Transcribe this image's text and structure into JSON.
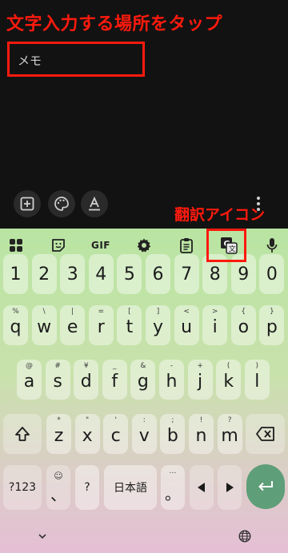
{
  "annotations": {
    "top": "文字入力する場所をタップ",
    "translate_icon": "翻訳アイコン"
  },
  "note": {
    "placeholder": "メモ"
  },
  "bottom_tools": [
    "add-box-icon",
    "palette-icon",
    "text-format-icon",
    "more-vert-icon"
  ],
  "keyboard_toolbar": {
    "icons": [
      "apps-grid-icon",
      "sticker-icon",
      "gif",
      "settings-gear-icon",
      "clipboard-icon",
      "translate-icon",
      "mic-icon"
    ],
    "gif_label": "GIF"
  },
  "keyboard": {
    "row1": [
      "1",
      "2",
      "3",
      "4",
      "5",
      "6",
      "7",
      "8",
      "9",
      "0"
    ],
    "row2": {
      "keys": [
        "q",
        "w",
        "e",
        "r",
        "t",
        "y",
        "u",
        "i",
        "o",
        "p"
      ],
      "hints": [
        "%",
        "\\",
        "|",
        "=",
        "[",
        "]",
        "<",
        ">",
        "{",
        "}"
      ]
    },
    "row3": {
      "keys": [
        "a",
        "s",
        "d",
        "f",
        "g",
        "h",
        "j",
        "k",
        "l"
      ],
      "hints": [
        "@",
        "#",
        "¥",
        "_",
        "&",
        "-",
        "+",
        "(",
        ")"
      ]
    },
    "row4": {
      "keys": [
        "z",
        "x",
        "c",
        "v",
        "b",
        "n",
        "m"
      ],
      "hints": [
        "*",
        "\"",
        "'",
        ":",
        ";",
        "!",
        "?"
      ]
    },
    "row5": {
      "symbols_label": "?123",
      "emoji_hint": "☺",
      "comma": "、",
      "question": "?",
      "lang_label": "日本語",
      "period": "。",
      "period_hint": "…"
    }
  },
  "colors": {
    "annotation_red": "#ff1a0e",
    "enter_key": "#5e9e78",
    "background": "#121212"
  }
}
